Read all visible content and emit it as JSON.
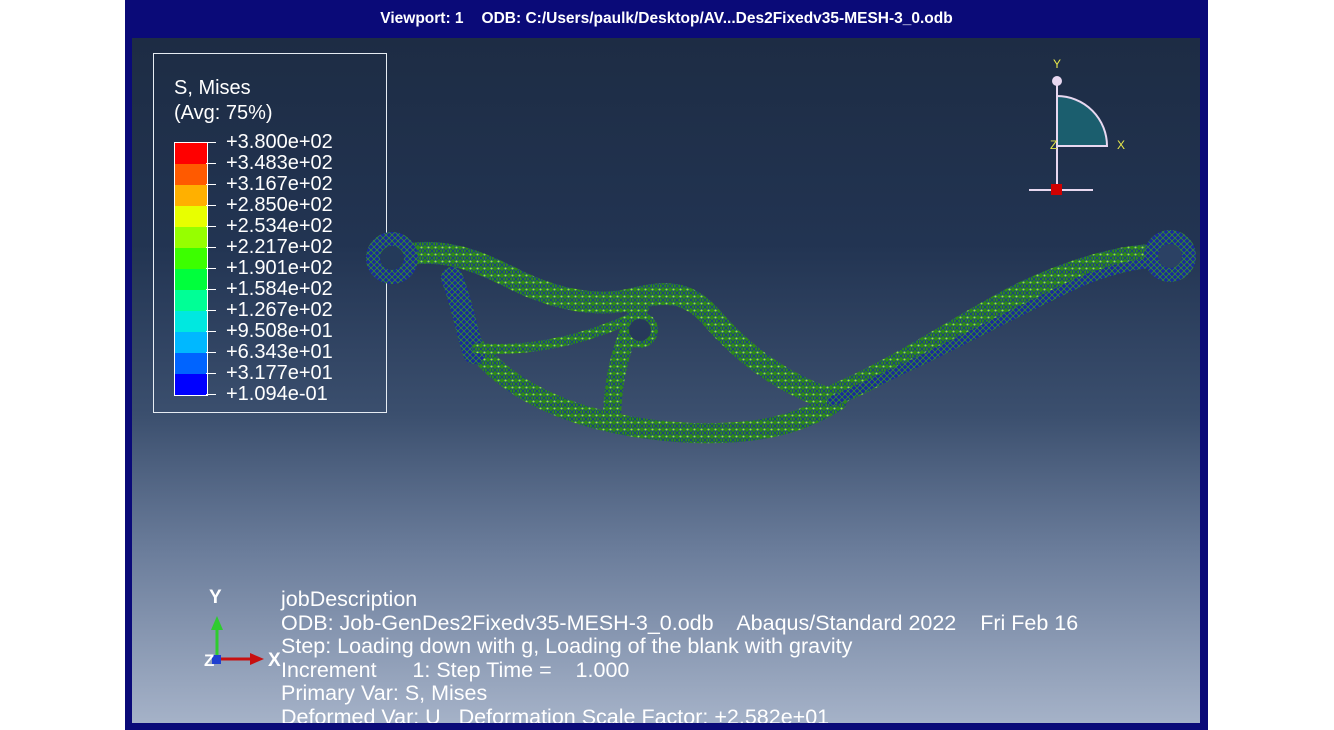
{
  "title_bar": {
    "viewport_label": "Viewport: 1",
    "odb_label": "ODB: C:/Users/paulk/Desktop/AV...Des2Fixedv35-MESH-3_0.odb"
  },
  "legend": {
    "title_line1": "S, Mises",
    "title_line2": "(Avg: 75%)",
    "values": [
      "+3.800e+02",
      "+3.483e+02",
      "+3.167e+02",
      "+2.850e+02",
      "+2.534e+02",
      "+2.217e+02",
      "+1.901e+02",
      "+1.584e+02",
      "+1.267e+02",
      "+9.508e+01",
      "+6.343e+01",
      "+3.177e+01",
      "+1.094e-01"
    ],
    "colors": [
      "#ff0000",
      "#ff5a00",
      "#ffb000",
      "#e8ff00",
      "#96ff00",
      "#3cff00",
      "#00ff3c",
      "#00ff96",
      "#00e8e0",
      "#00b8ff",
      "#0064ff",
      "#0000ff"
    ]
  },
  "triad_top_right": {
    "y_label": "Y",
    "x_label": "X",
    "z_label": "Z"
  },
  "triad_bottom_left": {
    "y_label": "Y",
    "x_label": "X",
    "z_label": "Z"
  },
  "info": {
    "job_description": "jobDescription",
    "odb_name": "ODB: Job-GenDes2Fixedv35-MESH-3_0.odb",
    "solver": "Abaqus/Standard 2022",
    "date": "Fri Feb 16",
    "step": "Step: Loading down with g, Loading of the blank with gravity",
    "increment": "Increment      1: Step Time =    1.000",
    "primary_var": "Primary Var: S, Mises",
    "deformed_var": "Deformed Var: U   Deformation Scale Factor: +2.582e+01"
  },
  "colors": {
    "frame": "#0a0a78",
    "viewport_top": "#1d2c44",
    "viewport_bottom": "#a5b2c8",
    "mesh_primary": "#3b9e1c",
    "mesh_low": "#1a2a9a"
  }
}
